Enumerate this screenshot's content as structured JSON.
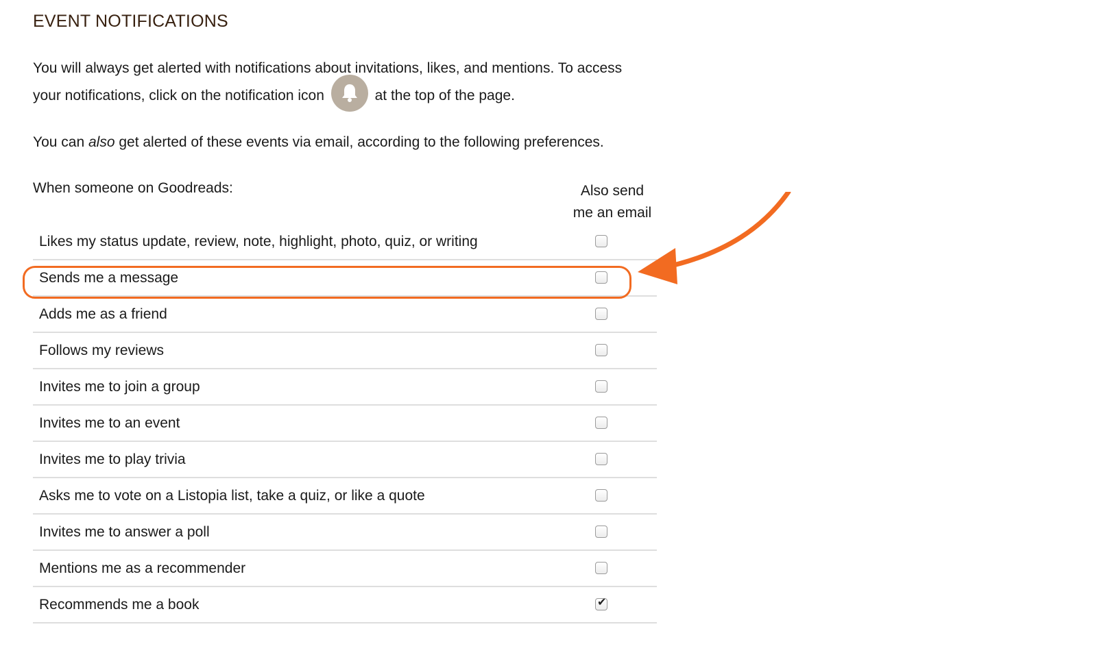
{
  "title": "EVENT NOTIFICATIONS",
  "intro": {
    "line1": "You will always get alerted with notifications about invitations, likes, and mentions. To access",
    "line2_before": "your notifications, click on the notification icon",
    "line2_after": "at the top of the page.",
    "icon": "bell-icon"
  },
  "also": {
    "before": "You can ",
    "emphasis": "also",
    "after": " get alerted of these events via email, according to the following preferences."
  },
  "columns": {
    "left": "When someone on Goodreads:",
    "right_line1": "Also send",
    "right_line2": "me an email"
  },
  "rows": [
    {
      "label": "Likes my status update, review, note, highlight, photo, quiz, or writing",
      "checked": false
    },
    {
      "label": "Sends me a message",
      "checked": false,
      "highlighted": true
    },
    {
      "label": "Adds me as a friend",
      "checked": false
    },
    {
      "label": "Follows my reviews",
      "checked": false
    },
    {
      "label": "Invites me to join a group",
      "checked": false
    },
    {
      "label": "Invites me to an event",
      "checked": false
    },
    {
      "label": "Invites me to play trivia",
      "checked": false
    },
    {
      "label": "Asks me to vote on a Listopia list, take a quiz, or like a quote",
      "checked": false
    },
    {
      "label": "Invites me to answer a poll",
      "checked": false
    },
    {
      "label": "Mentions me as a recommender",
      "checked": false
    },
    {
      "label": "Recommends me a book",
      "checked": true
    }
  ],
  "colors": {
    "title": "#382110",
    "highlight": "#f26b21",
    "bell_circle": "#b9aea0"
  }
}
